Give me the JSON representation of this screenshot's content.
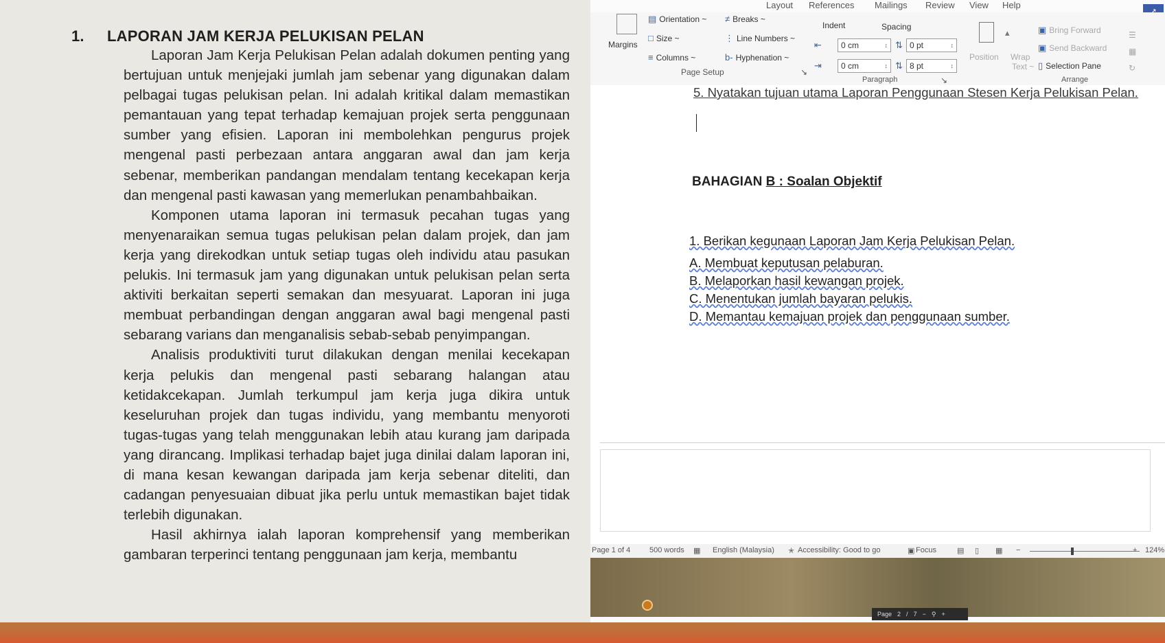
{
  "paper": {
    "heading_number": "1.",
    "heading_title": "LAPORAN JAM KERJA PELUKISAN PELAN",
    "paragraphs": [
      "Laporan Jam Kerja Pelukisan Pelan adalah dokumen penting yang bertujuan untuk menjejaki jumlah jam sebenar yang digunakan dalam pelbagai tugas pelukisan pelan. Ini adalah kritikal dalam memastikan pemantauan yang tepat terhadap kemajuan projek serta penggunaan sumber yang efisien. Laporan ini membolehkan pengurus projek mengenal pasti perbezaan antara anggaran awal dan jam kerja sebenar, memberikan pandangan mendalam tentang kecekapan kerja dan mengenal pasti kawasan yang memerlukan penambahbaikan.",
      "Komponen utama laporan ini termasuk pecahan tugas yang menyenaraikan semua tugas pelukisan pelan dalam projek, dan jam kerja yang direkodkan untuk setiap tugas oleh individu atau pasukan pelukis. Ini termasuk jam yang digunakan untuk pelukisan pelan serta aktiviti berkaitan seperti semakan dan mesyuarat. Laporan ini juga membuat perbandingan dengan anggaran awal bagi mengenal pasti sebarang varians dan menganalisis sebab-sebab penyimpangan.",
      "Analisis produktiviti turut dilakukan dengan menilai kecekapan kerja pelukis dan mengenal pasti sebarang halangan atau ketidakcekapan. Jumlah terkumpul jam kerja juga dikira untuk keseluruhan projek dan tugas individu, yang membantu menyoroti tugas-tugas yang telah menggunakan lebih atau kurang jam daripada yang dirancang. Implikasi terhadap bajet juga dinilai dalam laporan ini, di mana kesan kewangan daripada jam kerja sebenar diteliti, dan cadangan penyesuaian dibuat jika perlu untuk memastikan bajet tidak terlebih digunakan.",
      "Hasil akhirnya ialah laporan komprehensif yang memberikan gambaran terperinci tentang penggunaan jam kerja, membantu"
    ]
  },
  "word": {
    "tabs": [
      "Layout",
      "References",
      "Mailings",
      "Review",
      "View",
      "Help"
    ],
    "ribbon": {
      "orientation": "Orientation ~",
      "breaks": "Breaks ~",
      "margins": "Margins",
      "size": "Size ~",
      "line_numbers": "Line Numbers ~",
      "columns": "Columns ~",
      "hyphenation": "Hyphenation ~",
      "page_setup": "Page Setup",
      "indent": "Indent",
      "spacing": "Spacing",
      "indent_left": "0 cm",
      "indent_right": "0 cm",
      "spacing_before": "0 pt",
      "spacing_after": "8 pt",
      "paragraph": "Paragraph",
      "position": "Position",
      "wrap": "Wrap",
      "text": "Text ~",
      "bring_forward": "Bring Forward",
      "send_backward": "Send Backward",
      "selection_pane": "Selection Pane",
      "arrange": "Arrange"
    },
    "document": {
      "line5": "5. Nyatakan tujuan utama Laporan Penggunaan Stesen Kerja Pelukisan Pelan.",
      "section_prefix": "BAHAGIAN ",
      "section_underlined": "B : Soalan Objektif",
      "question": "1. Berikan kegunaan Laporan Jam Kerja Pelukisan Pelan.",
      "options": [
        "A. Membuat keputusan pelaburan.",
        "B. Melaporkan hasil kewangan projek.",
        "C. Menentukan jumlah bayaran pelukis.",
        "D. Memantau kemajuan projek dan penggunaan sumber."
      ]
    },
    "status": {
      "page": "Page 1 of 4",
      "words": "500 words",
      "language": "English (Malaysia)",
      "accessibility": "Accessibility: Good to go",
      "focus": "Focus",
      "zoom": "124%"
    }
  },
  "mini_toolbar": {
    "label": "Page",
    "page": "2",
    "sep": "/",
    "total": "7"
  }
}
